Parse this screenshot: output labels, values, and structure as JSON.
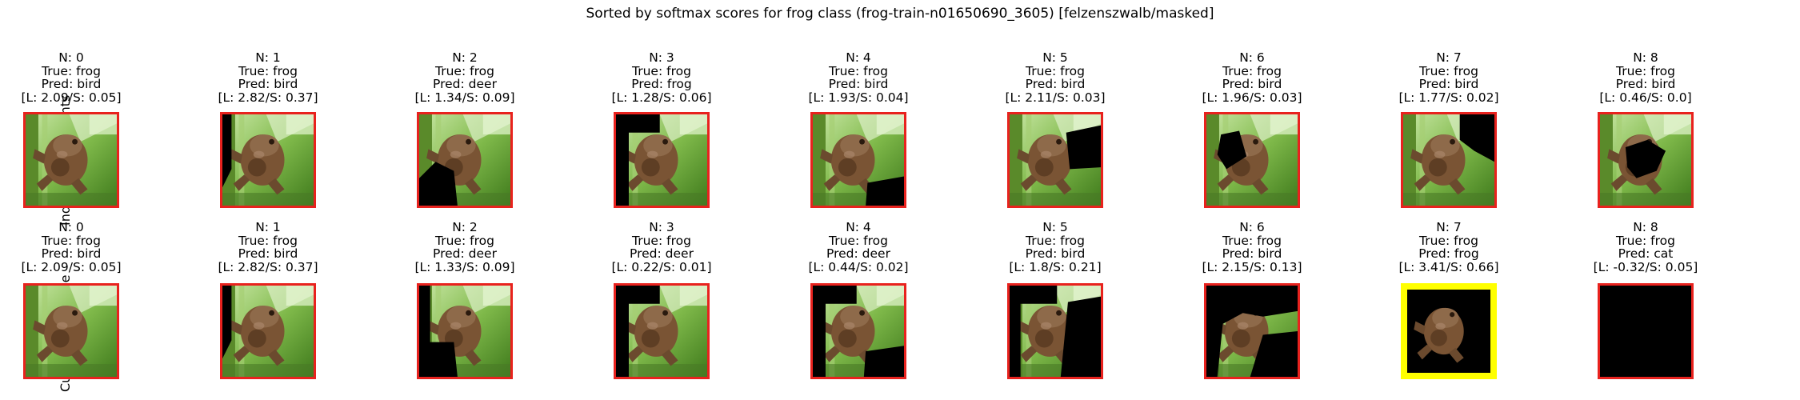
{
  "figure": {
    "title": "Sorted by softmax scores for frog class (frog-train-n01650690_3605) [felzenszwalb/masked]",
    "colors": {
      "default_frame": "#e8221e",
      "highlight_frame": "#ffff00",
      "mask": "#000000"
    },
    "rows": [
      {
        "label": "Individual Segments",
        "panels": [
          {
            "n": "N: 0",
            "true_label": "True: frog",
            "pred": "Pred: bird",
            "scores": "[L: 2.09/S: 0.05]",
            "highlight": false
          },
          {
            "n": "N: 1",
            "true_label": "True: frog",
            "pred": "Pred: bird",
            "scores": "[L: 2.82/S: 0.37]",
            "highlight": false
          },
          {
            "n": "N: 2",
            "true_label": "True: frog",
            "pred": "Pred: deer",
            "scores": "[L: 1.34/S: 0.09]",
            "highlight": false
          },
          {
            "n": "N: 3",
            "true_label": "True: frog",
            "pred": "Pred: frog",
            "scores": "[L: 1.28/S: 0.06]",
            "highlight": false
          },
          {
            "n": "N: 4",
            "true_label": "True: frog",
            "pred": "Pred: bird",
            "scores": "[L: 1.93/S: 0.04]",
            "highlight": false
          },
          {
            "n": "N: 5",
            "true_label": "True: frog",
            "pred": "Pred: bird",
            "scores": "[L: 2.11/S: 0.03]",
            "highlight": false
          },
          {
            "n": "N: 6",
            "true_label": "True: frog",
            "pred": "Pred: bird",
            "scores": "[L: 1.96/S: 0.03]",
            "highlight": false
          },
          {
            "n": "N: 7",
            "true_label": "True: frog",
            "pred": "Pred: bird",
            "scores": "[L: 1.77/S: 0.02]",
            "highlight": false
          },
          {
            "n": "N: 8",
            "true_label": "True: frog",
            "pred": "Pred: bird",
            "scores": "[L: 0.46/S: 0.0]",
            "highlight": false
          }
        ]
      },
      {
        "label": "Cumulative Image",
        "panels": [
          {
            "n": "N: 0",
            "true_label": "True: frog",
            "pred": "Pred: bird",
            "scores": "[L: 2.09/S: 0.05]",
            "highlight": false
          },
          {
            "n": "N: 1",
            "true_label": "True: frog",
            "pred": "Pred: bird",
            "scores": "[L: 2.82/S: 0.37]",
            "highlight": false
          },
          {
            "n": "N: 2",
            "true_label": "True: frog",
            "pred": "Pred: deer",
            "scores": "[L: 1.33/S: 0.09]",
            "highlight": false
          },
          {
            "n": "N: 3",
            "true_label": "True: frog",
            "pred": "Pred: deer",
            "scores": "[L: 0.22/S: 0.01]",
            "highlight": false
          },
          {
            "n": "N: 4",
            "true_label": "True: frog",
            "pred": "Pred: deer",
            "scores": "[L: 0.44/S: 0.02]",
            "highlight": false
          },
          {
            "n": "N: 5",
            "true_label": "True: frog",
            "pred": "Pred: bird",
            "scores": "[L: 1.8/S: 0.21]",
            "highlight": false
          },
          {
            "n": "N: 6",
            "true_label": "True: frog",
            "pred": "Pred: bird",
            "scores": "[L: 2.15/S: 0.13]",
            "highlight": false
          },
          {
            "n": "N: 7",
            "true_label": "True: frog",
            "pred": "Pred: frog",
            "scores": "[L: 3.41/S: 0.66]",
            "highlight": true
          },
          {
            "n": "N: 8",
            "true_label": "True: frog",
            "pred": "Pred: cat",
            "scores": "[L: -0.32/S: 0.05]",
            "highlight": false
          }
        ]
      }
    ]
  }
}
